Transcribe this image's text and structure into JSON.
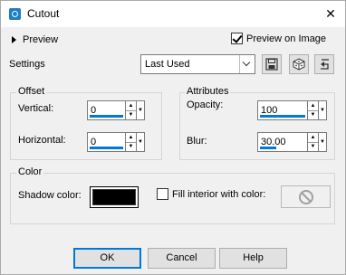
{
  "window": {
    "title": "Cutout",
    "close_glyph": "✕"
  },
  "preview": {
    "label": "Preview",
    "preview_on_image_label": "Preview on Image",
    "preview_on_image_checked": true
  },
  "settings": {
    "label": "Settings",
    "preset_value": "Last Used"
  },
  "offset": {
    "label": "Offset",
    "vertical_label": "Vertical:",
    "vertical_value": "0",
    "horizontal_label": "Horizontal:",
    "horizontal_value": "0"
  },
  "attributes": {
    "label": "Attributes",
    "opacity_label": "Opacity:",
    "opacity_value": "100",
    "blur_label": "Blur:",
    "blur_value": "30.00"
  },
  "color": {
    "label": "Color",
    "shadow_color_label": "Shadow color:",
    "shadow_color": "#000000",
    "fill_interior_label": "Fill interior with color:",
    "fill_interior_checked": false
  },
  "buttons": {
    "ok": "OK",
    "cancel": "Cancel",
    "help": "Help"
  },
  "icons": [
    "app-icon",
    "save-preset-icon",
    "randomize-icon",
    "reset-icon",
    "no-color-icon"
  ],
  "colors": {
    "accent": "#0078d7",
    "dialog_bg": "#f0f0f0"
  }
}
